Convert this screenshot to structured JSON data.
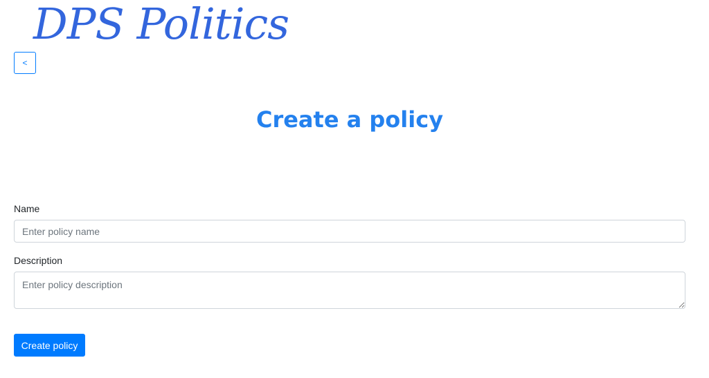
{
  "header": {
    "logo_text": "DPS Politics",
    "back_label": "<"
  },
  "main": {
    "title": "Create a policy"
  },
  "form": {
    "name_label": "Name",
    "name_placeholder": "Enter policy name",
    "name_value": "",
    "description_label": "Description",
    "description_placeholder": "Enter policy description",
    "description_value": "",
    "submit_label": "Create policy"
  },
  "colors": {
    "brand": "#3366dd",
    "primary": "#007bff",
    "title": "#2481ee"
  }
}
